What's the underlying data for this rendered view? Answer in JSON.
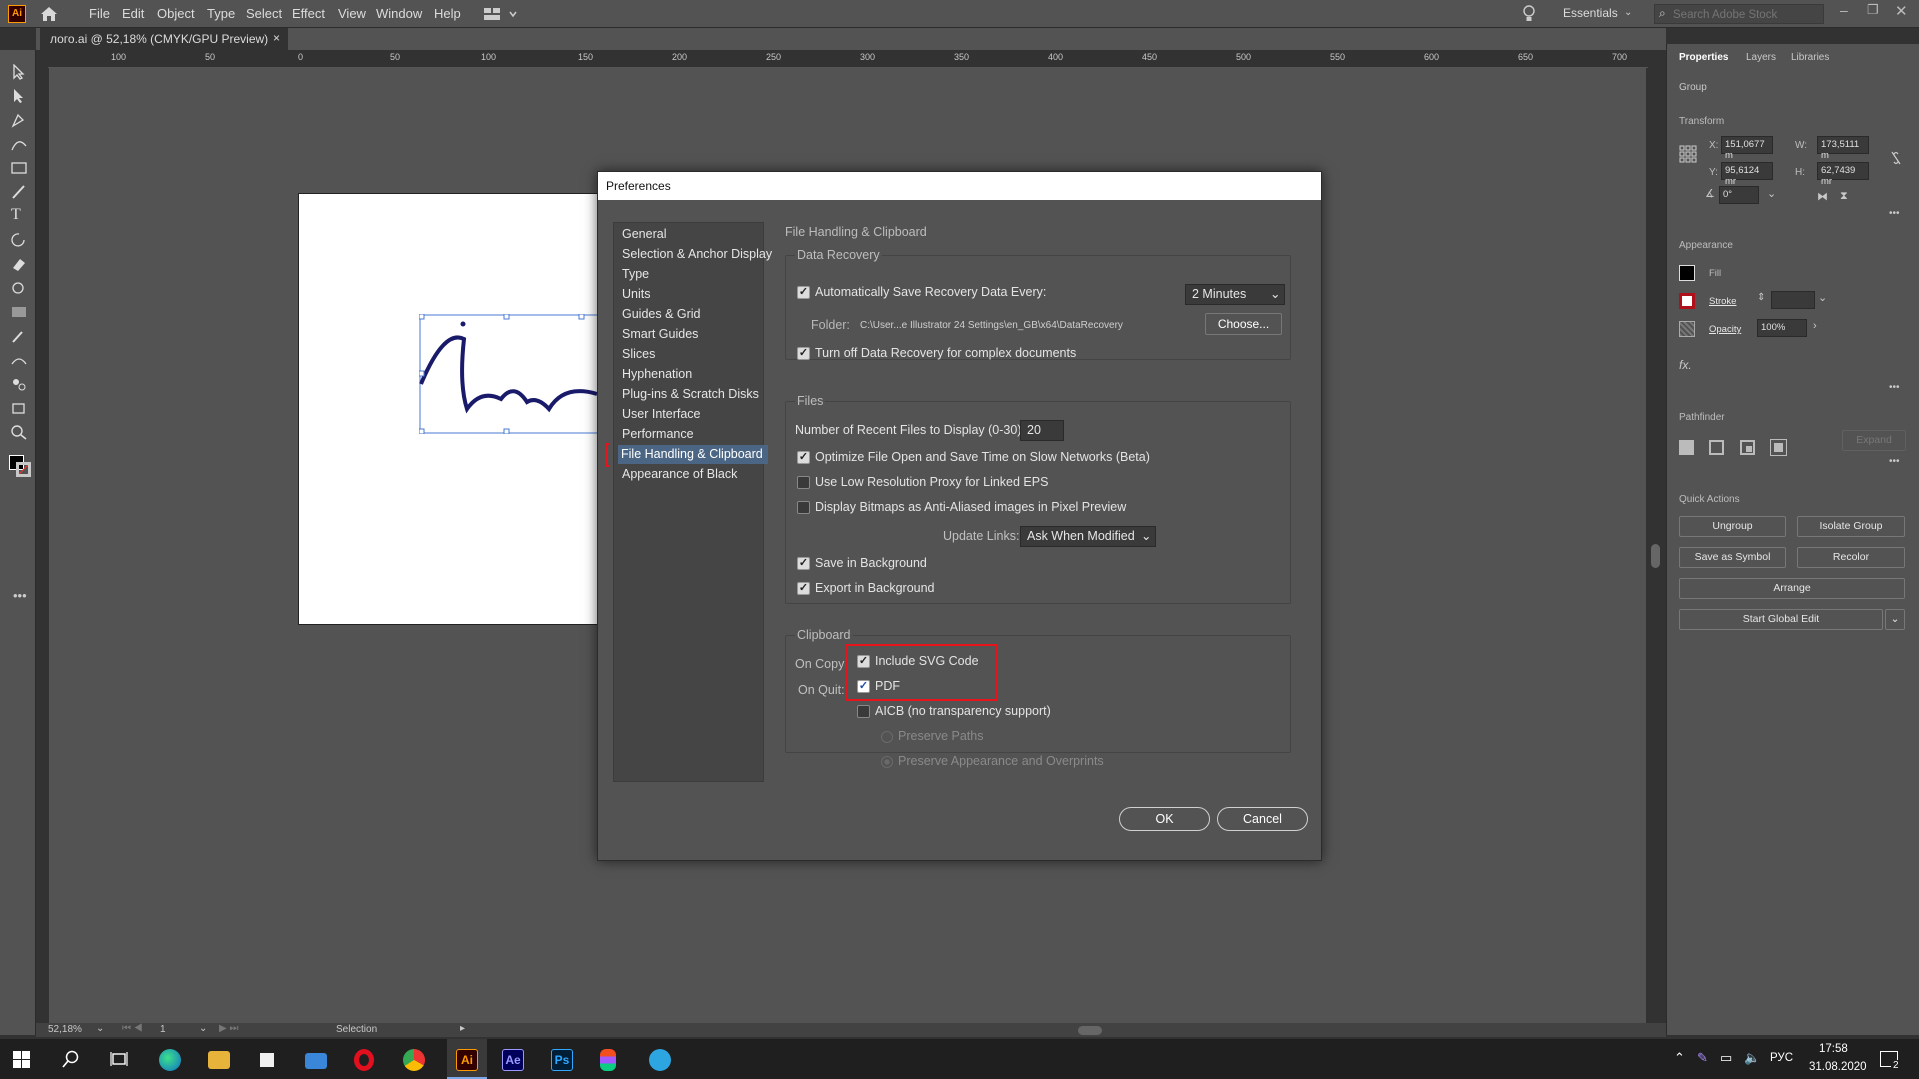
{
  "menubar": {
    "logo": "Ai",
    "items": [
      "File",
      "Edit",
      "Object",
      "Type",
      "Select",
      "Effect",
      "View",
      "Window",
      "Help"
    ],
    "workspace": "Essentials",
    "search_placeholder": "Search Adobe Stock"
  },
  "document_tab": {
    "title": "лого.ai @ 52,18% (CMYK/GPU Preview)",
    "close": "×"
  },
  "ruler_h_ticks": [
    "100",
    "50",
    "0",
    "50",
    "100",
    "150",
    "200",
    "250",
    "300",
    "350",
    "400",
    "450",
    "500",
    "550",
    "600",
    "650",
    "700"
  ],
  "right_panel": {
    "tabs": [
      "Properties",
      "Layers",
      "Libraries"
    ],
    "selection": "Group",
    "transform": {
      "title": "Transform",
      "x_label": "X:",
      "x": "151,0677 m",
      "y_label": "Y:",
      "y": "95,6124 mr",
      "w_label": "W:",
      "w": "173,5111 m",
      "h_label": "H:",
      "h": "62,7439 mr",
      "angle": "0°"
    },
    "appearance": {
      "title": "Appearance",
      "fill": "Fill",
      "stroke": "Stroke",
      "opacity": "Opacity",
      "opacity_value": "100%",
      "fx": "fx."
    },
    "pathfinder": {
      "title": "Pathfinder",
      "expand": "Expand"
    },
    "quick_actions": {
      "title": "Quick Actions",
      "ungroup": "Ungroup",
      "isolate": "Isolate Group",
      "save_symbol": "Save as Symbol",
      "recolor": "Recolor",
      "arrange": "Arrange",
      "global_edit": "Start Global Edit"
    }
  },
  "status": {
    "zoom": "52,18%",
    "page": "1",
    "tool": "Selection"
  },
  "taskbar": {
    "lang": "РУС",
    "time": "17:58",
    "date": "31.08.2020",
    "notif": "2"
  },
  "dialog": {
    "title": "Preferences",
    "categories": [
      "General",
      "Selection & Anchor Display",
      "Type",
      "Units",
      "Guides & Grid",
      "Smart Guides",
      "Slices",
      "Hyphenation",
      "Plug-ins & Scratch Disks",
      "User Interface",
      "Performance",
      "File Handling & Clipboard",
      "Appearance of Black"
    ],
    "selected_category": "File Handling & Clipboard",
    "heading": "File Handling & Clipboard",
    "data_recovery": {
      "title": "Data Recovery",
      "auto_save": "Automatically Save Recovery Data Every:",
      "interval": "2 Minutes",
      "folder_label": "Folder:",
      "folder_path": "C:\\User...e Illustrator 24 Settings\\en_GB\\x64\\DataRecovery",
      "choose": "Choose...",
      "turn_off": "Turn off Data Recovery for complex documents"
    },
    "files": {
      "title": "Files",
      "recent_label": "Number of Recent Files to Display (0-30):",
      "recent_value": "20",
      "optimize": "Optimize File Open and Save Time on Slow Networks (Beta)",
      "low_res": "Use Low Resolution Proxy for Linked EPS",
      "bitmaps": "Display Bitmaps as Anti-Aliased images in Pixel Preview",
      "update_label": "Update Links:",
      "update_value": "Ask When Modified",
      "save_bg": "Save in Background",
      "export_bg": "Export in Background"
    },
    "clipboard": {
      "title": "Clipboard",
      "on_copy": "On Copy:",
      "on_quit": "On Quit:",
      "svg": "Include SVG Code",
      "pdf": "PDF",
      "aicb": "AICB (no transparency support)",
      "preserve_paths": "Preserve Paths",
      "preserve_appearance": "Preserve Appearance and Overprints"
    },
    "ok": "OK",
    "cancel": "Cancel"
  }
}
